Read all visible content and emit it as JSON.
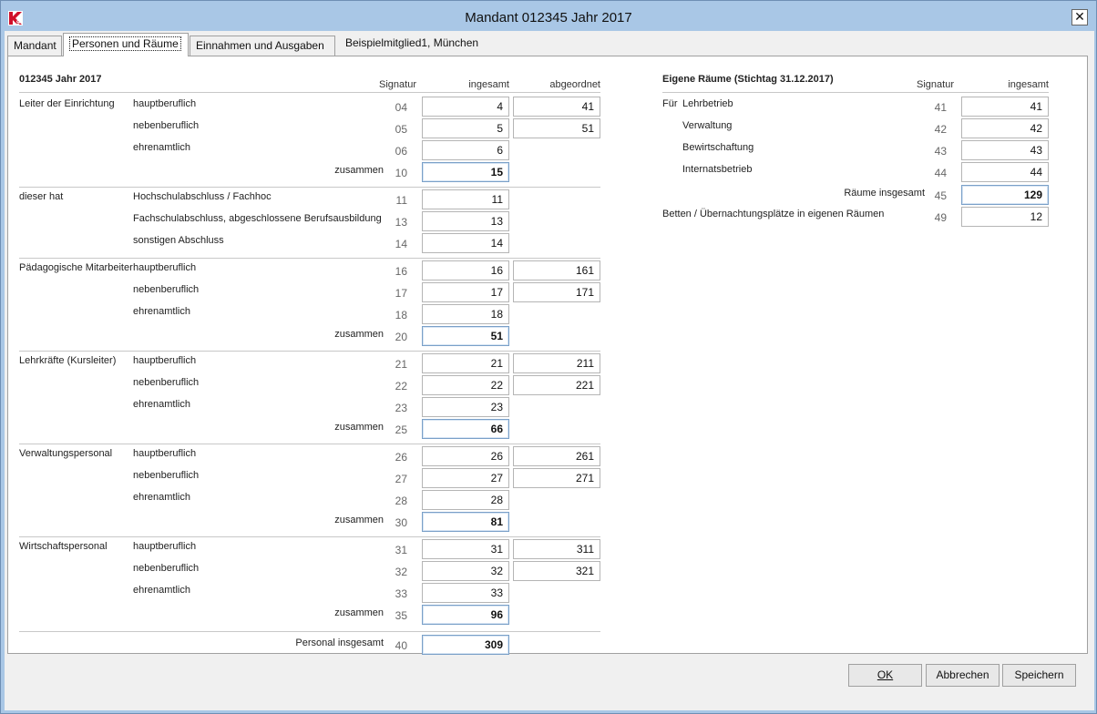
{
  "window": {
    "title": "Mandant 012345 Jahr 2017",
    "close": "✕",
    "logo_text": "K9"
  },
  "tabs": [
    {
      "label": "Mandant"
    },
    {
      "label": "Personen und Räume"
    },
    {
      "label": "Einnahmen und Ausgaben"
    }
  ],
  "tab_info": "Beispielmitglied1, München",
  "left": {
    "heading": "012345 Jahr 2017",
    "col_signatur": "Signatur",
    "col_ingesamt": "ingesamt",
    "col_abgeordnet": "abgeordnet",
    "groups": [
      {
        "label": "Leiter der Einrichtung",
        "rows": [
          {
            "sub": "hauptberuflich",
            "sig": "04",
            "ingesamt": "4",
            "abgeordnet": "41"
          },
          {
            "sub": "nebenberuflich",
            "sig": "05",
            "ingesamt": "5",
            "abgeordnet": "51"
          },
          {
            "sub": "ehrenamtlich",
            "sig": "06",
            "ingesamt": "6"
          },
          {
            "sub": "zusammen",
            "sig": "10",
            "ingesamt": "15",
            "sum": true
          }
        ]
      },
      {
        "label": "dieser hat",
        "rows": [
          {
            "sub": "Hochschulabschluss / Fachhoc",
            "sig": "11",
            "ingesamt": "11"
          },
          {
            "sub": "Fachschulabschluss, abgeschlossene Berufsausbildung",
            "sig": "13",
            "ingesamt": "13"
          },
          {
            "sub": "sonstigen Abschluss",
            "sig": "14",
            "ingesamt": "14"
          }
        ]
      },
      {
        "label": "Pädagogische Mitarbeiter",
        "rows": [
          {
            "sub": "hauptberuflich",
            "sig": "16",
            "ingesamt": "16",
            "abgeordnet": "161"
          },
          {
            "sub": "nebenberuflich",
            "sig": "17",
            "ingesamt": "17",
            "abgeordnet": "171"
          },
          {
            "sub": "ehrenamtlich",
            "sig": "18",
            "ingesamt": "18"
          },
          {
            "sub": "zusammen",
            "sig": "20",
            "ingesamt": "51",
            "sum": true
          }
        ]
      },
      {
        "label": "Lehrkräfte (Kursleiter)",
        "rows": [
          {
            "sub": "hauptberuflich",
            "sig": "21",
            "ingesamt": "21",
            "abgeordnet": "211"
          },
          {
            "sub": "nebenberuflich",
            "sig": "22",
            "ingesamt": "22",
            "abgeordnet": "221"
          },
          {
            "sub": "ehrenamtlich",
            "sig": "23",
            "ingesamt": "23"
          },
          {
            "sub": "zusammen",
            "sig": "25",
            "ingesamt": "66",
            "sum": true
          }
        ]
      },
      {
        "label": "Verwaltungspersonal",
        "rows": [
          {
            "sub": "hauptberuflich",
            "sig": "26",
            "ingesamt": "26",
            "abgeordnet": "261"
          },
          {
            "sub": "nebenberuflich",
            "sig": "27",
            "ingesamt": "27",
            "abgeordnet": "271"
          },
          {
            "sub": "ehrenamtlich",
            "sig": "28",
            "ingesamt": "28"
          },
          {
            "sub": "zusammen",
            "sig": "30",
            "ingesamt": "81",
            "sum": true
          }
        ]
      },
      {
        "label": "Wirtschaftspersonal",
        "rows": [
          {
            "sub": "hauptberuflich",
            "sig": "31",
            "ingesamt": "31",
            "abgeordnet": "311"
          },
          {
            "sub": "nebenberuflich",
            "sig": "32",
            "ingesamt": "32",
            "abgeordnet": "321"
          },
          {
            "sub": "ehrenamtlich",
            "sig": "33",
            "ingesamt": "33"
          },
          {
            "sub": "zusammen",
            "sig": "35",
            "ingesamt": "96",
            "sum": true
          }
        ]
      }
    ],
    "total": {
      "label": "Personal insgesamt",
      "sig": "40",
      "value": "309"
    }
  },
  "right": {
    "heading": "Eigene Räume (Stichtag 31.12.2017)",
    "col_signatur": "Signatur",
    "col_ingesamt": "ingesamt",
    "fuer": "Für",
    "rows": [
      {
        "label": "Lehrbetrieb",
        "sig": "41",
        "value": "41"
      },
      {
        "label": "Verwaltung",
        "sig": "42",
        "value": "42"
      },
      {
        "label": "Bewirtschaftung",
        "sig": "43",
        "value": "43"
      },
      {
        "label": "Internatsbetrieb",
        "sig": "44",
        "value": "44"
      }
    ],
    "total": {
      "label": "Räume insgesamt",
      "sig": "45",
      "value": "129"
    },
    "betten": {
      "label": "Betten / Übernachtungsplätze in eigenen Räumen",
      "sig": "49",
      "value": "12"
    }
  },
  "buttons": {
    "ok": "OK",
    "cancel": "Abbrechen",
    "save": "Speichern"
  }
}
